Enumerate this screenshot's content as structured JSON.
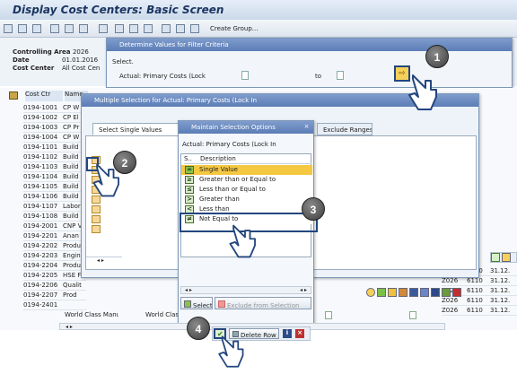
{
  "screen": {
    "title": "Display Cost Centers: Basic Screen"
  },
  "toolbar": {
    "create_group": "Create Group..."
  },
  "header": {
    "rows": [
      {
        "label": "Controlling Area",
        "value": "2026"
      },
      {
        "label": "Date",
        "value": "01.01.2016"
      },
      {
        "label": "Cost Center",
        "value": "All Cost Cen"
      }
    ]
  },
  "filter_dialog": {
    "title": "Determine Values for Filter Criteria",
    "select_label": "Select.",
    "field_label": "Actual: Primary Costs (Lock",
    "to_label": "to"
  },
  "list": {
    "col_costctr": "Cost Ctr",
    "col_name": "Name",
    "rows": [
      {
        "id": "0194-1001",
        "name": "CP W"
      },
      {
        "id": "0194-1002",
        "name": "CP El"
      },
      {
        "id": "0194-1003",
        "name": "CP Pr"
      },
      {
        "id": "0194-1004",
        "name": "CP W"
      },
      {
        "id": "0194-1101",
        "name": "Build"
      },
      {
        "id": "0194-1102",
        "name": "Build"
      },
      {
        "id": "0194-1103",
        "name": "Build"
      },
      {
        "id": "0194-1104",
        "name": "Build"
      },
      {
        "id": "0194-1105",
        "name": "Build"
      },
      {
        "id": "0194-1106",
        "name": "Build"
      },
      {
        "id": "0194-1107",
        "name": "Labor"
      },
      {
        "id": "0194-1108",
        "name": "Build"
      },
      {
        "id": "0194-2001",
        "name": "CNP V"
      },
      {
        "id": "0194-2201",
        "name": "Anan"
      },
      {
        "id": "0194-2202",
        "name": "Produ"
      },
      {
        "id": "0194-2203",
        "name": "Engin"
      },
      {
        "id": "0194-2204",
        "name": "Produ"
      },
      {
        "id": "0194-2205",
        "name": "HSE F"
      },
      {
        "id": "0194-2206",
        "name": "Qualit"
      },
      {
        "id": "0194-2207",
        "name": "Prod"
      },
      {
        "id": "0194-2401",
        "name": "World Class Manufcrg"
      }
    ],
    "last_name2": "World Clas",
    "right_rows": [
      {
        "a": "Z026",
        "b": "6110",
        "c": "31.12."
      },
      {
        "a": "Z026",
        "b": "6110",
        "c": "31.12."
      },
      {
        "a": "Z026",
        "b": "6110",
        "c": "31.12."
      },
      {
        "a": "Z026",
        "b": "6110",
        "c": "31.12."
      },
      {
        "a": "Z026",
        "b": "6110",
        "c": "31.12."
      }
    ]
  },
  "multi_sel": {
    "title": "Multiple Selection for Actual: Primary Costs (Lock In",
    "tab_single": "Select Single Values",
    "tab_exclude": "Exclude Ranges"
  },
  "maintain": {
    "title": "Maintain Selection Options",
    "field": "Actual: Primary Costs (Lock In",
    "col_s": "S..",
    "col_desc": "Description",
    "options": [
      {
        "icon": "=",
        "label": "Single Value",
        "selected": true
      },
      {
        "icon": "≥",
        "label": "Greater than or Equal to",
        "selected": false
      },
      {
        "icon": "≤",
        "label": "Less than or Equal to",
        "selected": false
      },
      {
        "icon": ">",
        "label": "Greater than",
        "selected": false
      },
      {
        "icon": "<",
        "label": "Less than",
        "selected": false
      },
      {
        "icon": "≠",
        "label": "Not Equal to",
        "selected": false
      }
    ],
    "select_btn": "Select",
    "exclude_btn": "Exclude from Selection"
  },
  "bottom_bar": {
    "delete_row": "Delete Row"
  },
  "callouts": [
    "1",
    "2",
    "3",
    "4"
  ],
  "colors": {
    "dialog_title": "#5b7db6",
    "selected": "#f5c842",
    "callout": "#3d3d3d"
  }
}
